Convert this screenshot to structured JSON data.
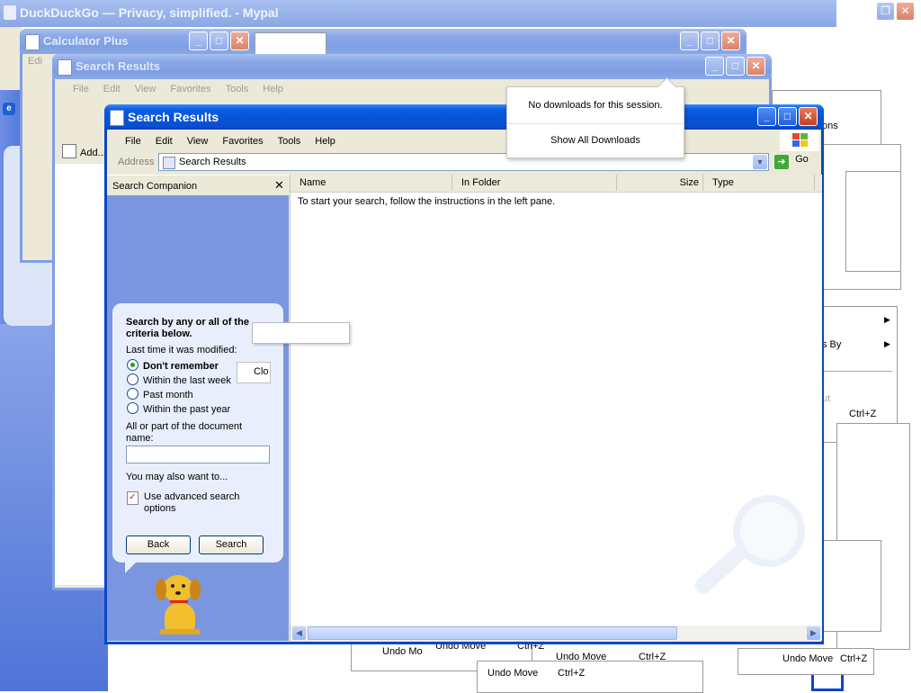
{
  "background_windows": {
    "duckduckgo_title": "DuckDuckGo — Privacy, simplified. - Mypal",
    "calculator_title": "Calculator Plus",
    "search_results_back_title": "Search Results",
    "back_menu": [
      "File",
      "Edit",
      "View",
      "Favorites",
      "Tools",
      "Help"
    ],
    "add_label": "Add...",
    "calc_edit_fragment": "Edi"
  },
  "downloads_popup": {
    "message": "No downloads for this session.",
    "show_all": "Show All Downloads"
  },
  "main_window": {
    "title": "Search Results",
    "menu": [
      "File",
      "Edit",
      "View",
      "Favorites",
      "Tools",
      "Help"
    ],
    "address_label": "Address",
    "address_value": "Search Results",
    "go_label": "Go",
    "companion_title": "Search Companion",
    "columns": [
      "Name",
      "In Folder",
      "Size",
      "Type"
    ],
    "results_message": "To start your search, follow the instructions in the left pane."
  },
  "search_panel": {
    "heading": "Search by any or all of the criteria below.",
    "modified_label": "Last time it was modified:",
    "options": [
      "Don't remember",
      "Within the last week",
      "Past month",
      "Within the past year"
    ],
    "selected_option": "Don't remember",
    "name_label": "All or part of the document name:",
    "name_value": "",
    "also_label": "You may also want to...",
    "advanced_label": "Use advanced search options",
    "back_button": "Back",
    "search_button": "Search",
    "clo_fragment": "Clo"
  },
  "right_side_fragments": {
    "ons": "ons",
    "sort_by": "s By",
    "ut": "ut",
    "ctrl_z": "Ctrl+Z"
  },
  "undo_fragments": {
    "undo_move": "Undo Move",
    "undo_mo": "Undo Mo",
    "ctrl_z": "Ctrl+Z"
  },
  "colors": {
    "xp_blue": "#0847c5",
    "companion_blue": "#7a96df",
    "desktop_blue": "#5a7edc"
  }
}
